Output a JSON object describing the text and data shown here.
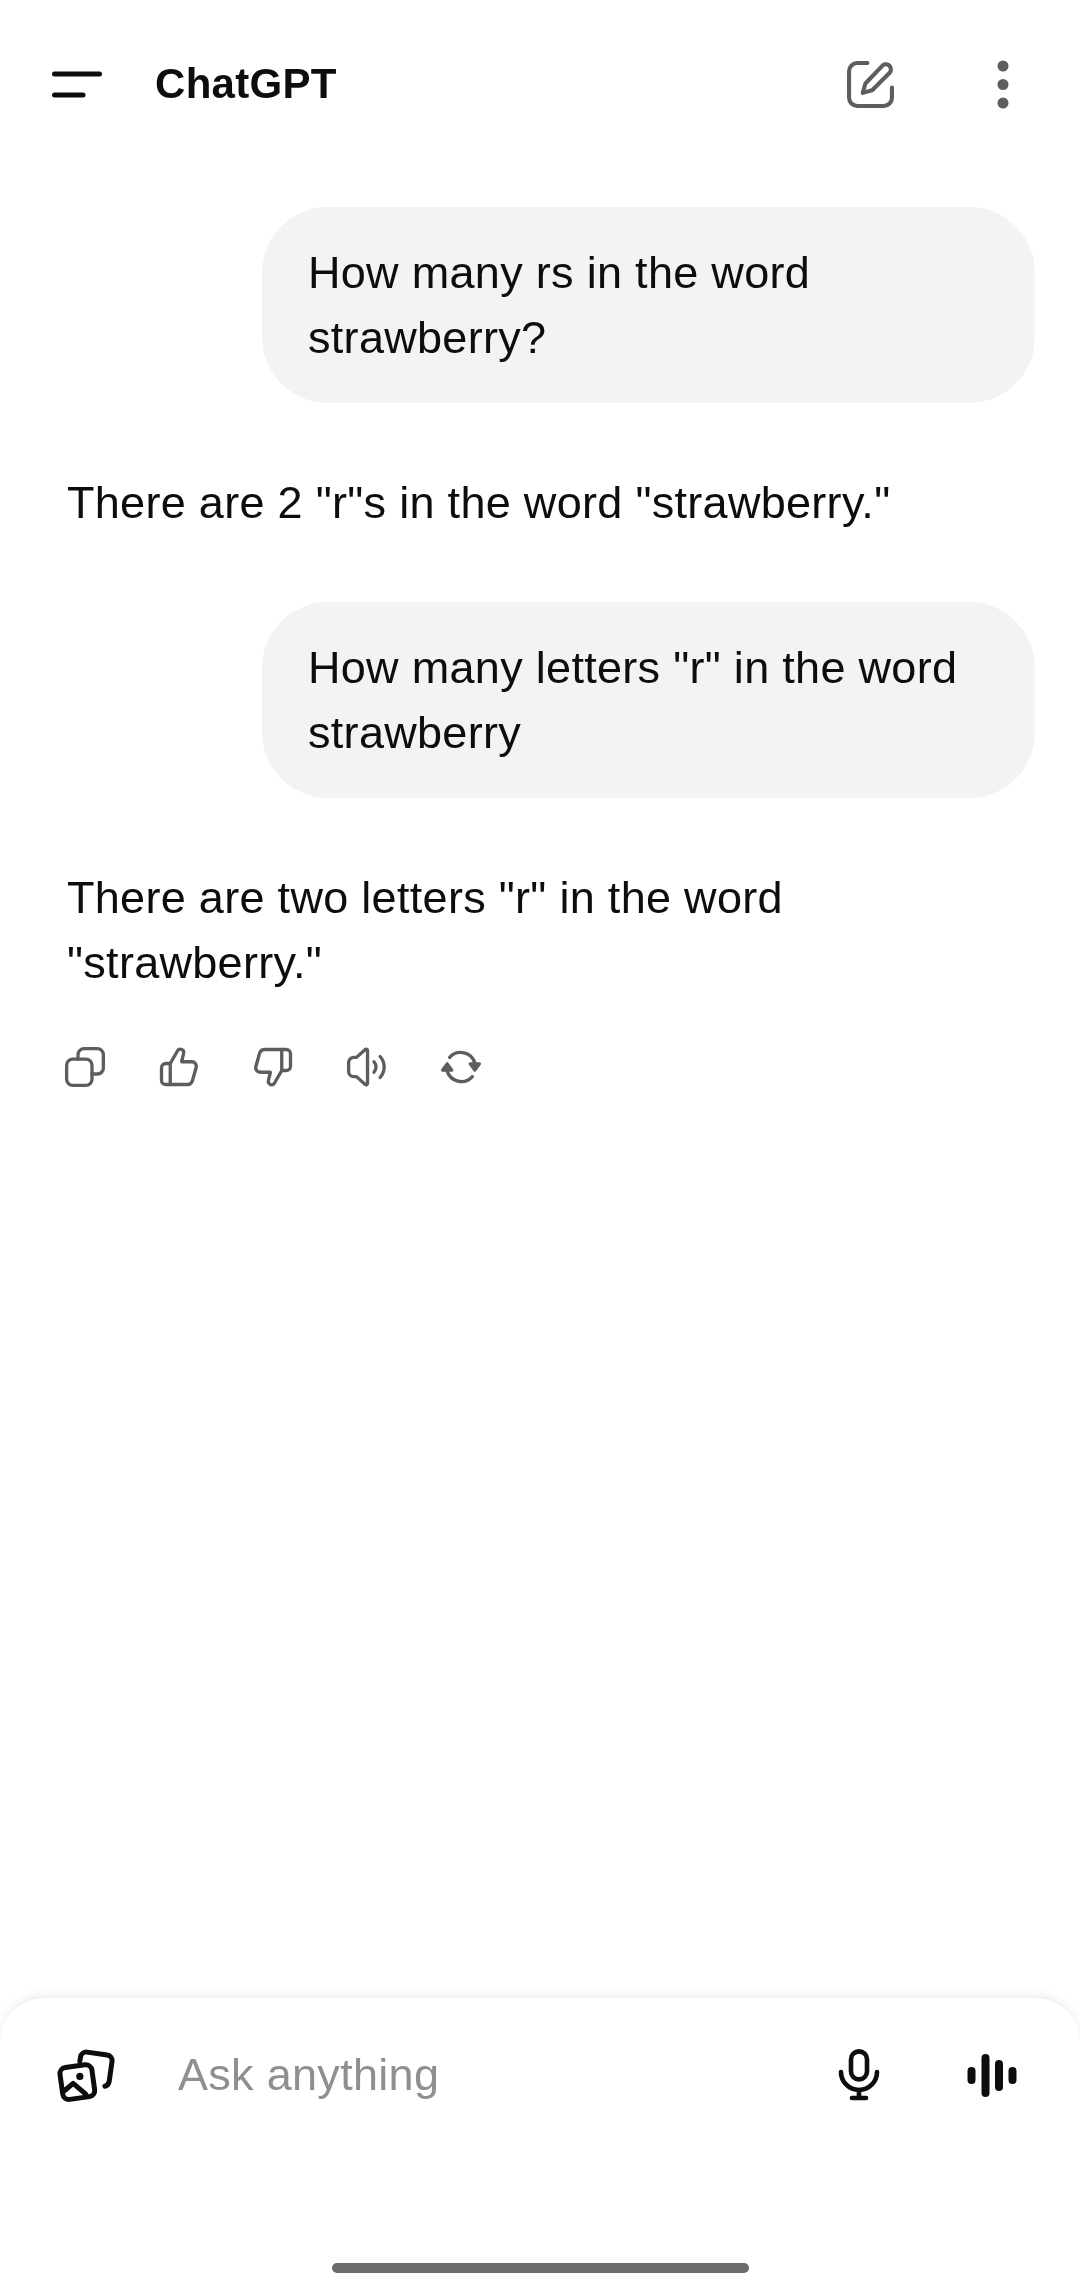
{
  "app_bar": {
    "title": "ChatGPT"
  },
  "messages": [
    {
      "kind": "user",
      "text": "How many rs in the word strawberry?"
    },
    {
      "kind": "assistant",
      "text": "There are 2 \"r\"s in the word \"strawberry.\""
    },
    {
      "kind": "user",
      "text": "How many letters \"r\" in the word strawberry"
    },
    {
      "kind": "assistant",
      "text": "There are two letters \"r\" in the word \"strawberry.\""
    }
  ],
  "composer": {
    "placeholder": "Ask anything"
  }
}
